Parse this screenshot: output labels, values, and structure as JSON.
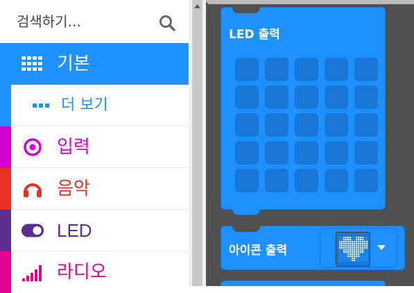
{
  "search": {
    "placeholder": "검색하기..."
  },
  "categories": [
    {
      "label": "기본",
      "icon": "grid-icon",
      "color": "#1e90ff"
    },
    {
      "label": "더 보기",
      "icon": "more-icon",
      "color": "#1e90ff"
    },
    {
      "label": "입력",
      "icon": "target-icon",
      "color": "#d400d4"
    },
    {
      "label": "음악",
      "icon": "headphones-icon",
      "color": "#e63022"
    },
    {
      "label": "LED",
      "icon": "toggle-icon",
      "color": "#5c2d91"
    },
    {
      "label": "라디오",
      "icon": "signal-bars-icon",
      "color": "#e3008c"
    }
  ],
  "workspace": {
    "led_block": {
      "title": "LED 출력",
      "rows": 5,
      "cols": 5
    },
    "icon_block": {
      "title": "아이콘 출력",
      "icon": "heart-icon",
      "dropdown_icon": "caret-down-icon"
    }
  },
  "colors": {
    "block": "#1e90ff",
    "workspace_bg": "#505050"
  }
}
